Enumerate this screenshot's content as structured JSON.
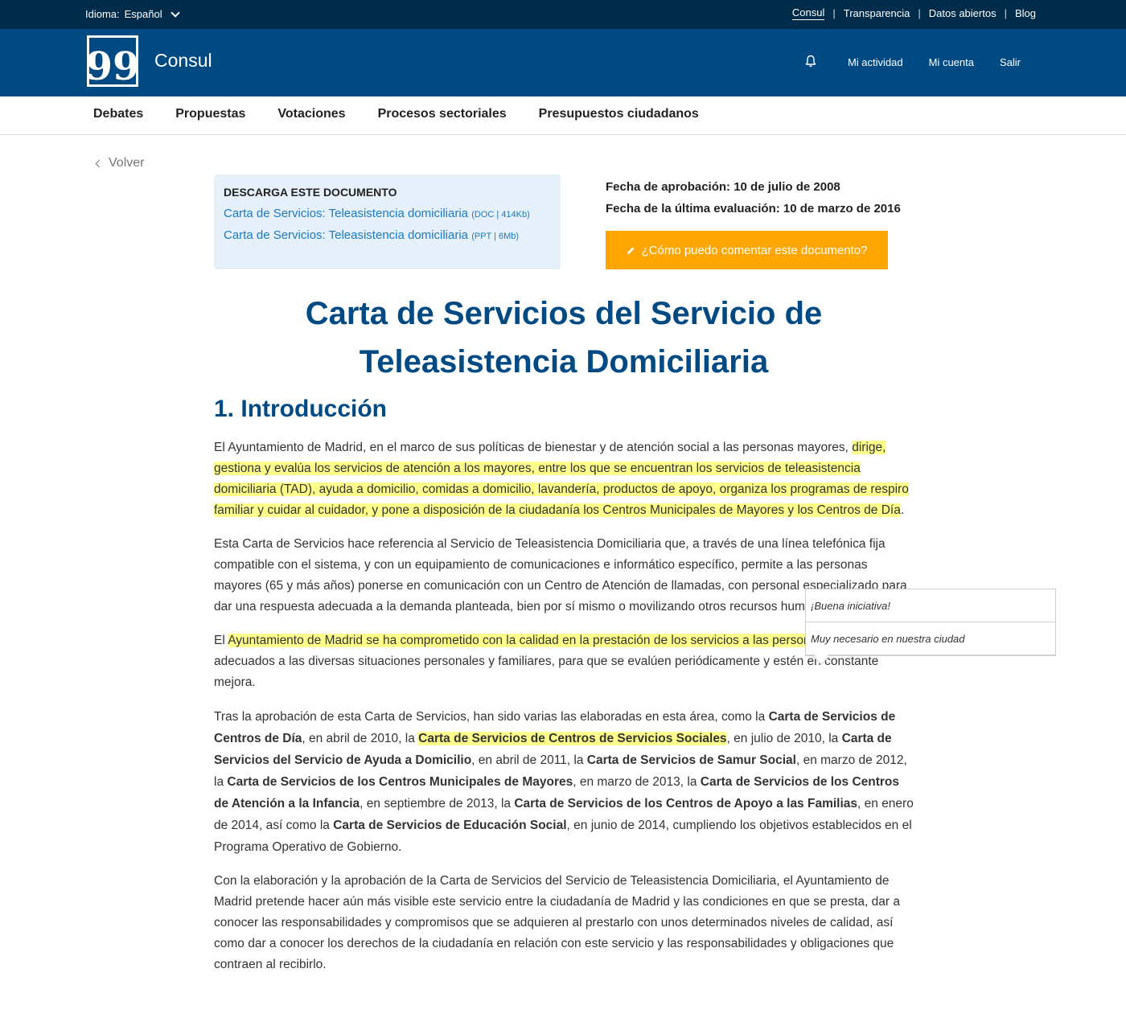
{
  "topbar": {
    "language_label": "Idioma:",
    "language_value": "Español",
    "links": [
      "Consul",
      "Transparencia",
      "Datos abiertos",
      "Blog"
    ]
  },
  "header": {
    "logo_glyph": "99",
    "brand": "Consul",
    "user_links": [
      "Mi actividad",
      "Mi cuenta",
      "Salir"
    ]
  },
  "nav": {
    "items": [
      "Debates",
      "Propuestas",
      "Votaciones",
      "Procesos sectoriales",
      "Presupuestos ciudadanos"
    ]
  },
  "back_label": "Volver",
  "download": {
    "heading": "DESCARGA ESTE DOCUMENTO",
    "files": [
      {
        "name": "Carta de Servicios: Teleasistencia domiciliaria",
        "meta": "(DOC | 414Kb)"
      },
      {
        "name": "Carta de Servicios: Teleasistencia domiciliaria",
        "meta": "(PPT | 6Mb)"
      }
    ]
  },
  "dates": {
    "approval": "Fecha de aprobación: 10 de julio de 2008",
    "evaluation": "Fecha de la última evaluación: 10 de marzo de 2016"
  },
  "comment_button": "¿Cómo puedo comentar este documento?",
  "document": {
    "title_line1": "Carta de Servicios del Servicio de",
    "title_line2": "Teleasistencia Domiciliaria",
    "section_title": "1. Introducción",
    "p1": {
      "a": "El Ayuntamiento de Madrid, en el marco de sus políticas de bienestar y de atención social a las personas mayores, ",
      "h1": "dirige, gestiona y evalúa los servicios de atención a los mayores, entre los que se encuentran los servicios de teleasistencia domiciliaria (TAD), ayuda a domicilio, comidas a domicilio, lavandería, productos de apoyo, organiza los programas de respiro familiar y cuidar al cuidador, y pone a disposición de la ciudadanía los ",
      "h2": "Centros Municipales de Mayores y los Centros de Día",
      "b": "."
    },
    "p2": "Esta Carta de Servicios hace referencia al Servicio de Teleasistencia Domiciliaria que, a través de una línea telefónica fija compatible con el sistema, y con un equipamiento de comunicaciones e informático específico, permite a las personas mayores (65 y más años) ponerse en comunicación con un Centro de Atención de llamadas, con personal especializado para dar una respuesta adecuada a la demanda planteada, bien por sí mismo o movilizando otros recursos humanos o materiales.",
    "p3": {
      "a": "El ",
      "h1": "Ayuntamiento de Madrid se ha comprometido con la calidad en la ",
      "h2": "prestación de los servicios a las personas mayores",
      "b": ", adecuados a las diversas situaciones personales y familiares, para que se evalúen periódicamente y estén en constante mejora."
    },
    "p4": {
      "t1": "Tras la aprobación de esta Carta de Servicios, han sido varias las elaboradas en esta área, como la ",
      "b1": "Carta de Servicios de Centros de Día",
      "t2": ", en abril de 2010, la ",
      "b2h1": "Carta de ",
      "b2h2": "Servicios de Centros de Servicios Sociales",
      "t3": ", en julio de 2010, la ",
      "b3": "Carta de Servicios del Servicio de Ayuda a Domicilio",
      "t4": ", en abril de 2011, la ",
      "b4": "Carta de Servicios de Samur Social",
      "t5": ", en marzo de 2012, la ",
      "b5": "Carta de Servicios de los Centros Municipales de Mayores",
      "t6": ", en marzo de 2013, la ",
      "b6": "Carta de Servicios de los Centros de Atención a la Infancia",
      "t7": ", en septiembre de 2013, la ",
      "b7": "Carta de Servicios de los Centros de Apoyo a las Familias",
      "t8": ", en enero de 2014, así como la ",
      "b8": "Carta de Servicios de Educación Social",
      "t9": ", en junio de 2014, cumpliendo los objetivos establecidos en el Programa Operativo de Gobierno."
    },
    "p5": "Con la elaboración y la aprobación de la Carta de Servicios del Servicio de Teleasistencia Domiciliaria, el Ayuntamiento de Madrid pretende hacer aún más visible este servicio entre la ciudadanía de Madrid y las condiciones en que se presta, dar a conocer las responsabilidades y compromisos que se adquieren al prestarlo con unos determinados niveles de calidad, así como dar a conocer los derechos de la ciudadanía en relación con este servicio y las responsabilidades y obligaciones que contraen al recibirlo."
  },
  "annotations": [
    "¡Buena iniciativa!",
    "Muy necesario en nuestra ciudad"
  ],
  "colors": {
    "topbar": "#002c4c",
    "header": "#004a83",
    "link": "#1a7bc1",
    "button": "#ffa700",
    "highlight": "#ffff8c",
    "download_bg": "#e6f0fa"
  }
}
